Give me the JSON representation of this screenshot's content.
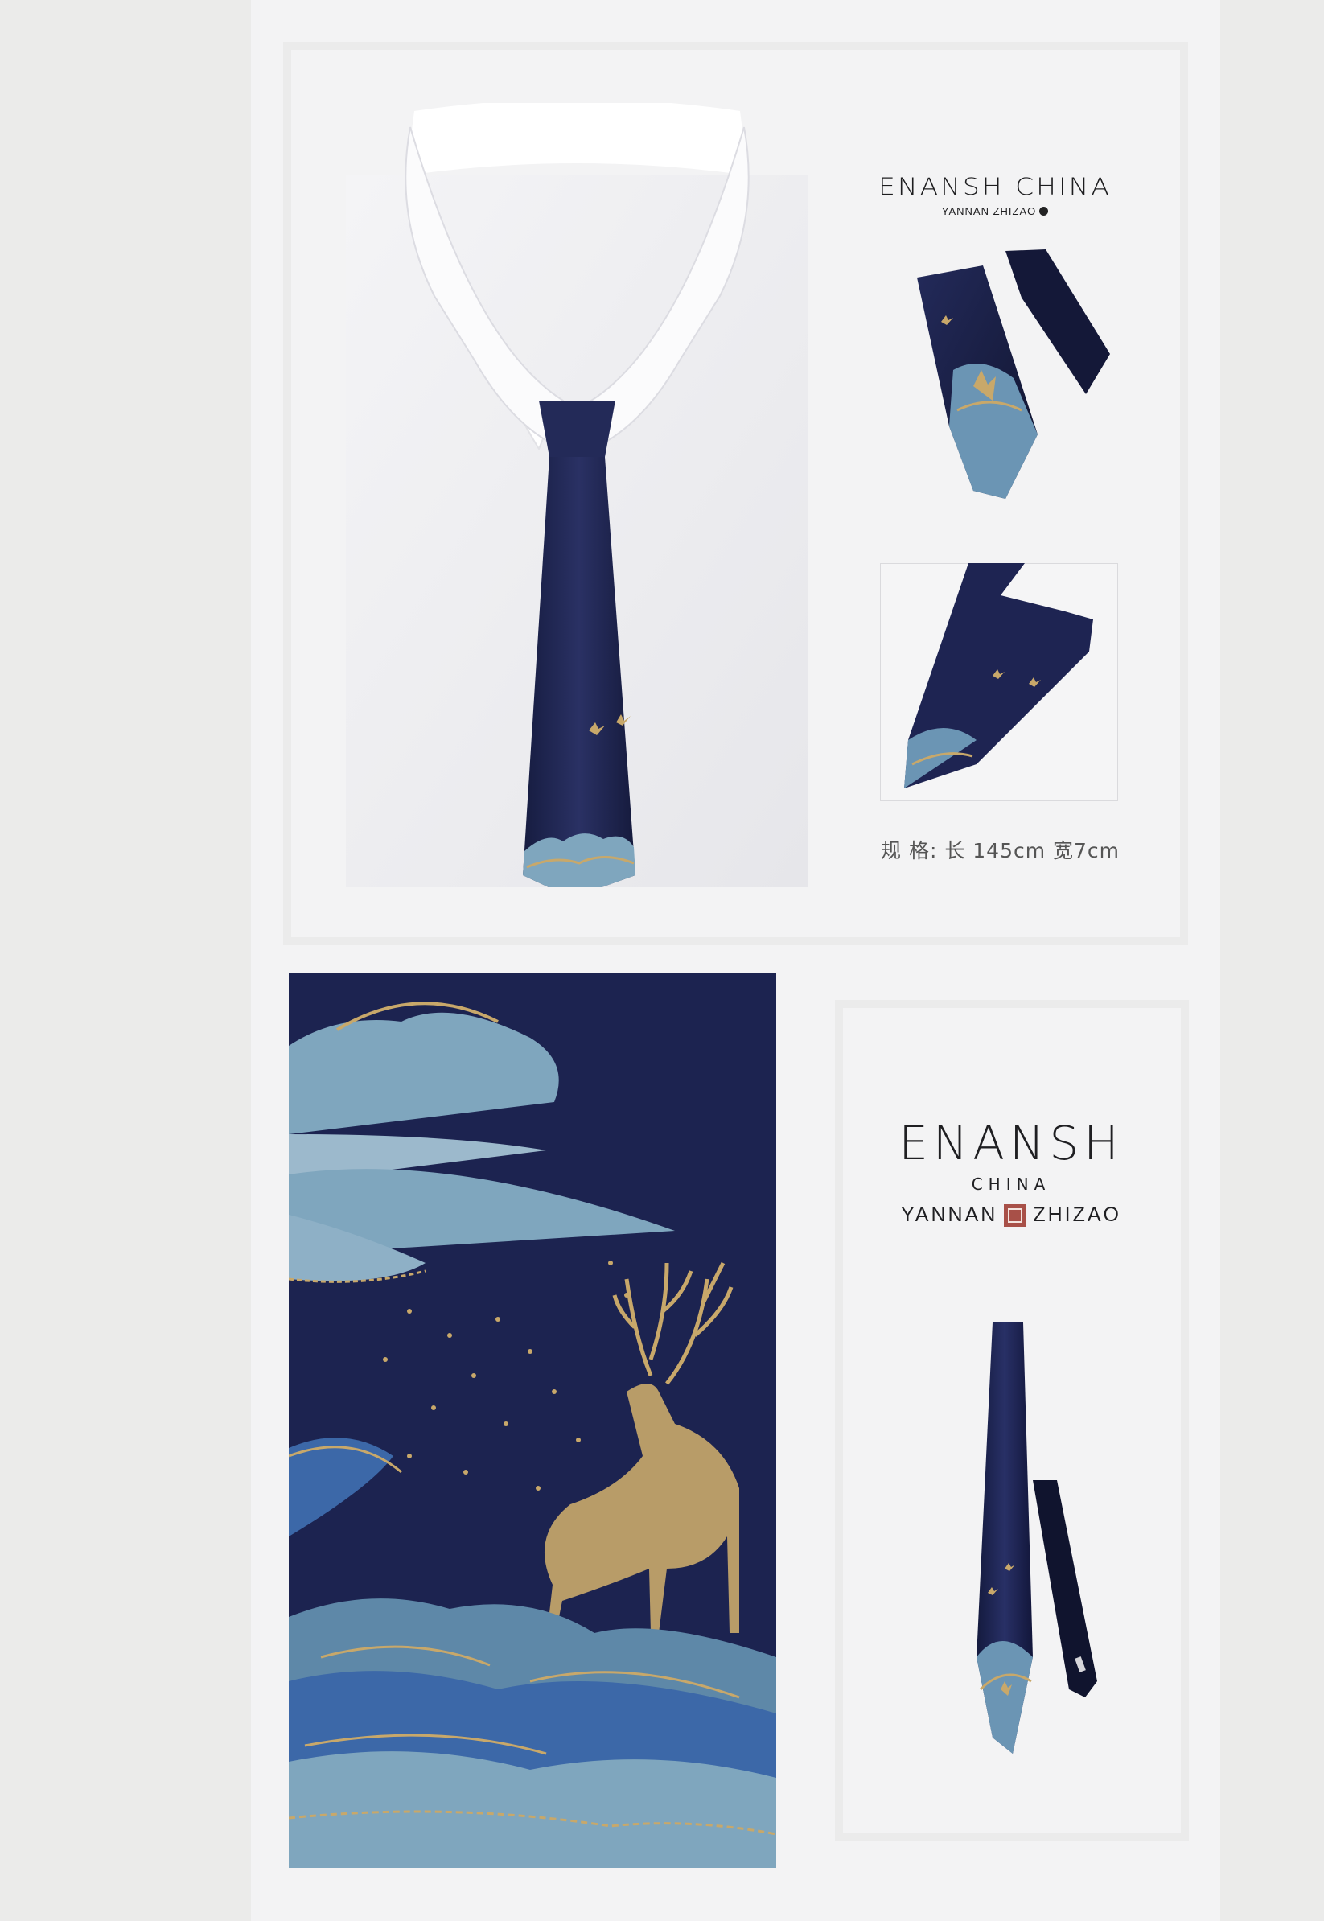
{
  "top_panel": {
    "brand_name": "ENANSH CHINA",
    "brand_sub": "YANNAN ZHIZAO",
    "spec_label": "规 格: 长 145cm 宽7cm"
  },
  "bottom_panel": {
    "brand_line1": "ENANSH",
    "brand_line2": "CHINA",
    "brand_left": "YANNAN",
    "brand_right": "ZHIZAO"
  },
  "colors": {
    "navy": "#1c2350",
    "gold": "#c8a86a",
    "sky_blue": "#7fa6be",
    "mid_blue": "#3c68a8"
  }
}
